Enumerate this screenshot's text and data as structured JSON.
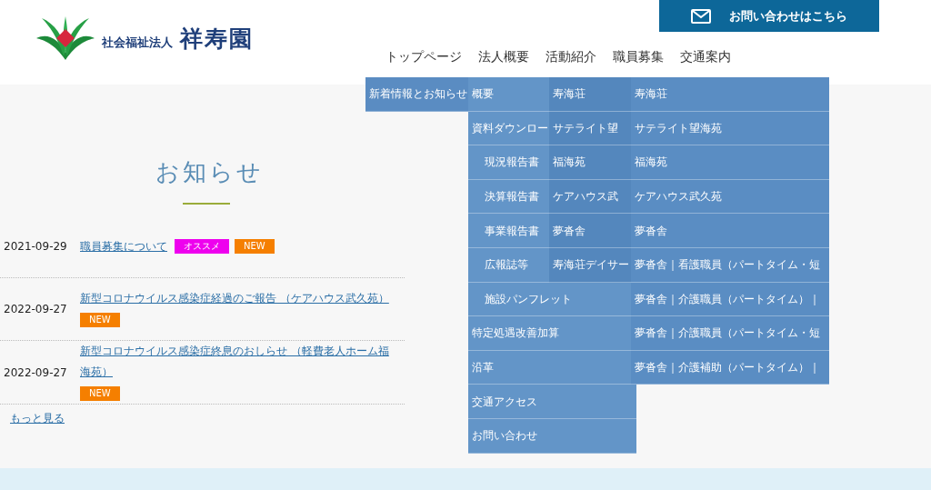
{
  "logo": {
    "caption": "社会福祉法人",
    "name": "祥寿園"
  },
  "contact_button": "お問い合わせはこちら",
  "nav": [
    {
      "label": "トップページ",
      "submenu": [
        {
          "label": "新着情報とお知らせ"
        }
      ]
    },
    {
      "label": "法人概要",
      "submenu": [
        {
          "label": "概要"
        },
        {
          "label": "資料ダウンロー",
          "children": [
            {
              "label": "現況報告書"
            },
            {
              "label": "決算報告書"
            },
            {
              "label": "事業報告書"
            },
            {
              "label": "広報誌等"
            },
            {
              "label": "施設パンフレット"
            }
          ]
        },
        {
          "label": "特定処遇改善加算"
        },
        {
          "label": "沿革"
        },
        {
          "label": "交通アクセス"
        },
        {
          "label": "お問い合わせ"
        }
      ]
    },
    {
      "label": "活動紹介",
      "submenu": [
        {
          "label": "寿海荘"
        },
        {
          "label": "サテライト望"
        },
        {
          "label": "福海苑"
        },
        {
          "label": "ケアハウス武"
        },
        {
          "label": "夢沓舎"
        },
        {
          "label": "寿海荘デイサー"
        }
      ]
    },
    {
      "label": "職員募集",
      "submenu": [
        {
          "label": "寿海荘"
        },
        {
          "label": "サテライト望海苑"
        },
        {
          "label": "福海苑"
        },
        {
          "label": "ケアハウス武久苑"
        },
        {
          "label": "夢沓舎"
        },
        {
          "label": "夢沓舎｜看護職員（パートタイム・短"
        },
        {
          "label": "夢沓舎｜介護職員（パートタイム）｜"
        },
        {
          "label": "夢沓舎｜介護職員（パートタイム・短"
        },
        {
          "label": "夢沓舎｜介護補助（パートタイム）｜"
        }
      ]
    },
    {
      "label": "交通案内"
    }
  ],
  "news": {
    "title": "お知らせ",
    "items": [
      {
        "date": "2021-09-29",
        "title": "職員募集について",
        "tags": [
          {
            "kind": "recommend",
            "label": "オススメ"
          },
          {
            "kind": "new",
            "label": "NEW"
          }
        ]
      },
      {
        "date": "2022-09-27",
        "title": "新型コロナウイルス感染症経過のご報告 （ケアハウス武久苑）",
        "tags": [
          {
            "kind": "new",
            "label": "NEW"
          }
        ]
      },
      {
        "date": "2022-09-27",
        "title": "新型コロナウイルス感染症終息のおしらせ （軽費老人ホーム福海苑）",
        "tags": [
          {
            "kind": "new",
            "label": "NEW"
          }
        ]
      }
    ],
    "more": "もっと見る"
  }
}
